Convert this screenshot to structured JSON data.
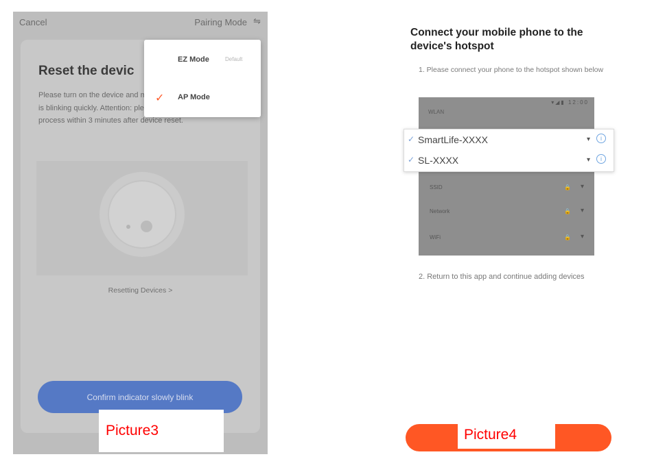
{
  "picture3": {
    "header": {
      "cancel": "Cancel",
      "pairing_mode": "Pairing Mode",
      "pairing_caret": "⇋"
    },
    "title": "Reset the devic",
    "description": "Please turn on the device and make sure the indicator is blinking quickly. Attention: please complete pairing process within 3 minutes after device reset.",
    "reset_link": "Resetting Devices >",
    "confirm_button": "Confirm indicator slowly blink",
    "mode_menu": {
      "ez_mode": "EZ Mode",
      "ez_default": "Default",
      "ap_mode": "AP Mode",
      "selected_mark": "✓"
    },
    "caption": "Picture3"
  },
  "picture4": {
    "title": "Connect your mobile phone to the device's hotspot",
    "step1": "1. Please connect your phone to the hotspot shown below",
    "panel": {
      "top_label": "WLAN",
      "status_icons": "▾◢▮ 12:00",
      "networks": [
        {
          "name": "SmartLife-XXXX",
          "check": "✓",
          "wifi": "▾",
          "info": "i"
        },
        {
          "name": "SL-XXXX",
          "check": "✓",
          "wifi": "▾",
          "info": "i"
        }
      ],
      "rows": [
        {
          "name": "SSID",
          "lock": "🔒",
          "wifi": "▾"
        },
        {
          "name": "Network",
          "lock": "🔒",
          "wifi": "▾"
        },
        {
          "name": "WiFi",
          "lock": "🔒",
          "wifi": "▾"
        }
      ]
    },
    "step2": "2. Return to this app and continue adding devices",
    "caption": "Picture4"
  },
  "colors": {
    "accent_orange": "#ff5724",
    "confirm_blue": "#5579c5",
    "caption_red": "#ff0000"
  }
}
